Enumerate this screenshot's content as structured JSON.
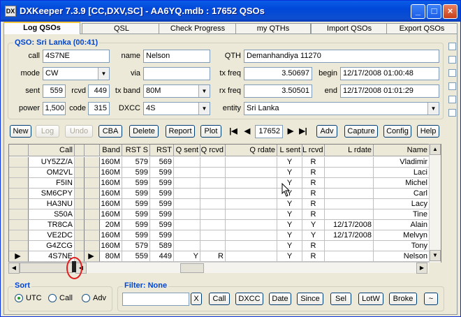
{
  "window": {
    "title": "DXKeeper 7.3.9 [CC,DXV,SC] - AA6YQ.mdb : 17652 QSOs",
    "app_icon": "DX"
  },
  "tabs": [
    "Log QSOs",
    "QSL",
    "Check Progress",
    "my QTHs",
    "Import QSOs",
    "Export QSOs"
  ],
  "qso": {
    "group_label": "QSO: Sri Lanka (00:41)",
    "call_label": "call",
    "call": "4S7NE",
    "name_label": "name",
    "name": "Nelson",
    "qth_label": "QTH",
    "qth": "Demanhandiya  11270",
    "mode_label": "mode",
    "mode": "CW",
    "via_label": "via",
    "via": "",
    "txfreq_label": "tx freq",
    "txfreq": "3.50697",
    "begin_label": "begin",
    "begin": "12/17/2008  01:00:48",
    "sent_label": "sent",
    "sent": "559",
    "rcvd_label": "rcvd",
    "rcvd": "449",
    "txband_label": "tx band",
    "txband": "80M",
    "rxfreq_label": "rx freq",
    "rxfreq": "3.50501",
    "end_label": "end",
    "end": "12/17/2008  01:01:29",
    "power_label": "power",
    "power": "1,500",
    "code_label": "code",
    "code": "315",
    "dxcc_label": "DXCC",
    "dxcc": "4S",
    "entity_label": "entity",
    "entity": "Sri Lanka"
  },
  "toolbar": {
    "new": "New",
    "log": "Log",
    "undo": "Undo",
    "cba": "CBA",
    "delete": "Delete",
    "report": "Report",
    "plot": "Plot",
    "record": "17652",
    "adv": "Adv",
    "capture": "Capture",
    "config": "Config",
    "help": "Help"
  },
  "grid": {
    "columns": [
      "Call",
      "Band",
      "RST S",
      "RST",
      "Q sent",
      "Q rcvd",
      "Q rdate",
      "L sent",
      "L rcvd",
      "L rdate",
      "Name"
    ],
    "rows": [
      [
        "UY5ZZ/A",
        "160M",
        "579",
        "569",
        "",
        "",
        "",
        "Y",
        "R",
        "",
        "Vladimir"
      ],
      [
        "OM2VL",
        "160M",
        "599",
        "599",
        "",
        "",
        "",
        "Y",
        "R",
        "",
        "Laci"
      ],
      [
        "F5IN",
        "160M",
        "599",
        "599",
        "",
        "",
        "",
        "Y",
        "R",
        "",
        "Michel"
      ],
      [
        "SM6CPY",
        "160M",
        "599",
        "599",
        "",
        "",
        "",
        "Y",
        "R",
        "",
        "Carl"
      ],
      [
        "HA3NU",
        "160M",
        "599",
        "599",
        "",
        "",
        "",
        "Y",
        "R",
        "",
        "Lacy"
      ],
      [
        "S50A",
        "160M",
        "599",
        "599",
        "",
        "",
        "",
        "Y",
        "R",
        "",
        "Tine"
      ],
      [
        "TR8CA",
        "20M",
        "599",
        "599",
        "",
        "",
        "",
        "Y",
        "Y",
        "12/17/2008",
        "Alain"
      ],
      [
        "VE2DC",
        "160M",
        "599",
        "599",
        "",
        "",
        "",
        "Y",
        "Y",
        "12/17/2008",
        "Melvyn"
      ],
      [
        "G4ZCG",
        "160M",
        "579",
        "589",
        "",
        "",
        "",
        "Y",
        "R",
        "",
        "Tony"
      ],
      [
        "4S7NE",
        "80M",
        "559",
        "449",
        "Y",
        "R",
        "",
        "Y",
        "R",
        "",
        "Nelson"
      ]
    ]
  },
  "sort": {
    "label": "Sort",
    "utc": "UTC",
    "call": "Call",
    "adv": "Adv",
    "selected": "UTC"
  },
  "filter": {
    "label": "Filter: None",
    "input": "",
    "clear": "X",
    "call": "Call",
    "dxcc": "DXCC",
    "date": "Date",
    "since": "Since",
    "sel": "Sel",
    "lotw": "LotW",
    "broke": "Broke",
    "tilde": "~"
  },
  "colors": {
    "accent": "#0046d5",
    "title_bar": "#0148d8",
    "annotation": "#e02020"
  }
}
